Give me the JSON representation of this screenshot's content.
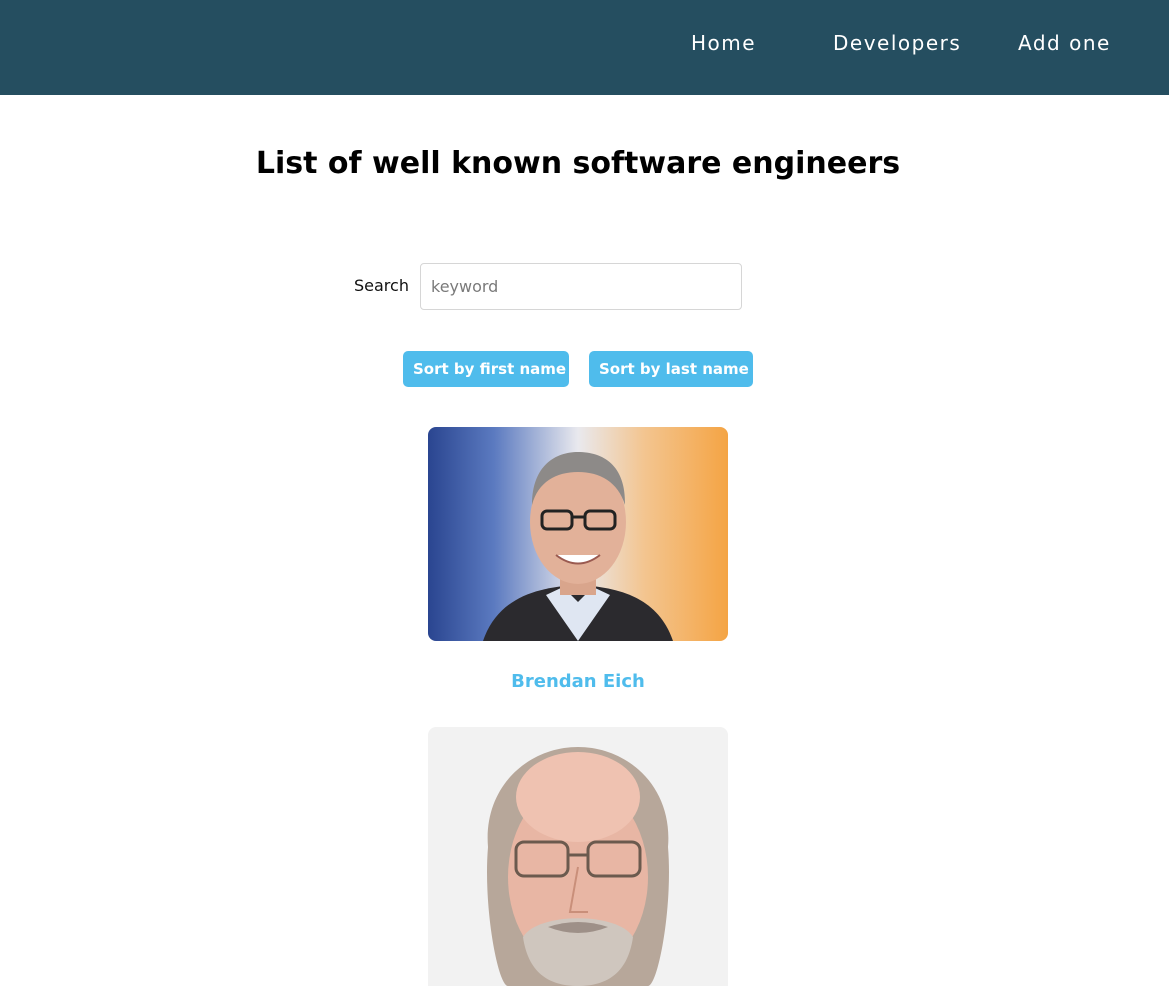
{
  "nav": {
    "links": [
      {
        "label": "Home"
      },
      {
        "label": "Developers"
      },
      {
        "label": "Add one"
      }
    ]
  },
  "page": {
    "title": "List of well known software engineers"
  },
  "search": {
    "label": "Search",
    "placeholder": "keyword",
    "value": ""
  },
  "sort": {
    "first_label": "Sort by first name",
    "last_label": "Sort by last name"
  },
  "developers": [
    {
      "name": "Brendan Eich"
    }
  ],
  "colors": {
    "navbar": "#254e60",
    "accent": "#4fbcec"
  }
}
